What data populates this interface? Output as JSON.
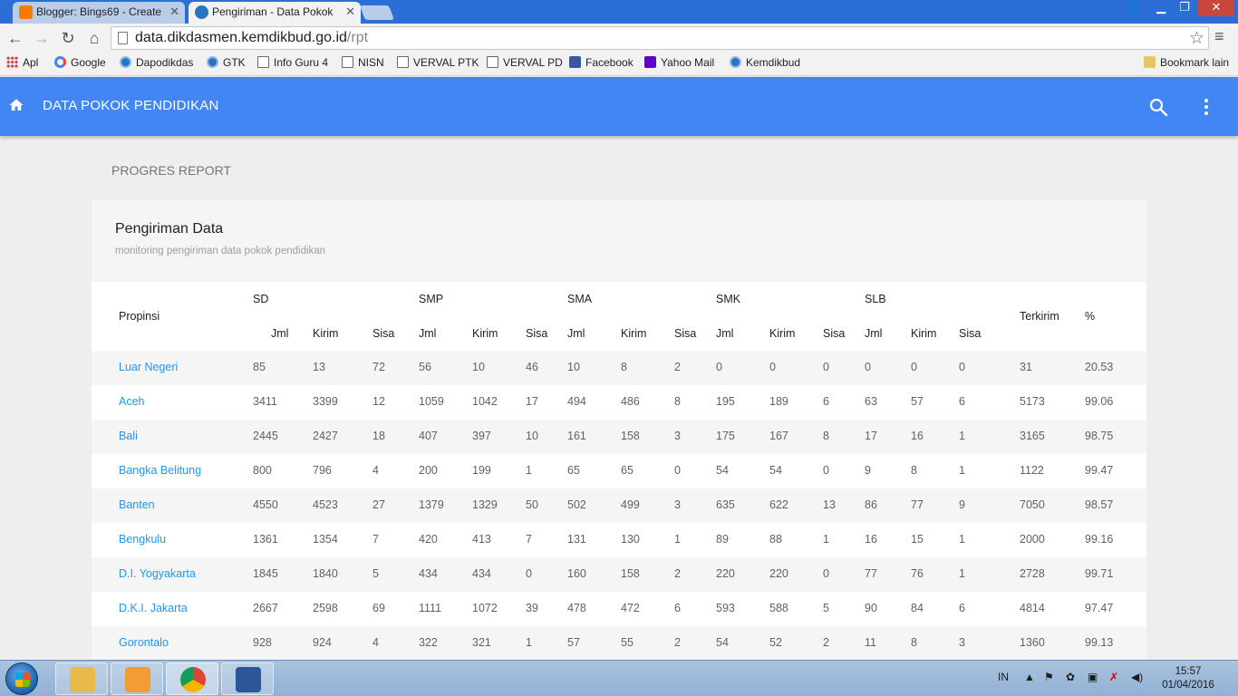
{
  "browser": {
    "tabs": [
      {
        "title": "Blogger: Bings69 - Create",
        "favicon": "blogger-icon",
        "color": "#f57c00"
      },
      {
        "title": "Pengiriman - Data Pokok",
        "favicon": "kemdikbud-icon",
        "color": "#2a73c0"
      }
    ],
    "url_host": "data.dikdasmen.kemdikbud.go.id",
    "url_path": "/rpt",
    "bookmarks": [
      {
        "label": "Apl",
        "icon": "apps-grid-icon"
      },
      {
        "label": "Google",
        "icon": "google-icon"
      },
      {
        "label": "Dapodikdas",
        "icon": "globe-icon"
      },
      {
        "label": "GTK",
        "icon": "globe-icon"
      },
      {
        "label": "Info Guru 4",
        "icon": "page-icon"
      },
      {
        "label": "NISN",
        "icon": "page-icon"
      },
      {
        "label": "VERVAL PTK",
        "icon": "page-icon"
      },
      {
        "label": "VERVAL PD",
        "icon": "page-icon"
      },
      {
        "label": "Facebook",
        "icon": "facebook-icon"
      },
      {
        "label": "Yahoo Mail",
        "icon": "yahoo-icon"
      },
      {
        "label": "Kemdikbud",
        "icon": "globe-icon"
      }
    ],
    "other_bookmarks": "Bookmark lain"
  },
  "app": {
    "title": "DATA POKOK PENDIDIKAN",
    "accent": "#4285f4",
    "breadcrumb": "PROGRES REPORT",
    "card_title": "Pengiriman Data",
    "card_subtitle": "monitoring pengiriman data pokok pendidikan"
  },
  "table": {
    "province_header": "Propinsi",
    "groups": [
      "SD",
      "SMP",
      "SMA",
      "SMK",
      "SLB"
    ],
    "sub_headers": [
      "Jml",
      "Kirim",
      "Sisa"
    ],
    "terkirim_header": "Terkirim",
    "percent_header": "%",
    "rows": [
      {
        "prov": "Luar Negeri",
        "v": [
          "85",
          "13",
          "72",
          "56",
          "10",
          "46",
          "10",
          "8",
          "2",
          "0",
          "0",
          "0",
          "0",
          "0",
          "0"
        ],
        "terkirim": "31",
        "pct": "20.53"
      },
      {
        "prov": "Aceh",
        "v": [
          "3411",
          "3399",
          "12",
          "1059",
          "1042",
          "17",
          "494",
          "486",
          "8",
          "195",
          "189",
          "6",
          "63",
          "57",
          "6"
        ],
        "terkirim": "5173",
        "pct": "99.06"
      },
      {
        "prov": "Bali",
        "v": [
          "2445",
          "2427",
          "18",
          "407",
          "397",
          "10",
          "161",
          "158",
          "3",
          "175",
          "167",
          "8",
          "17",
          "16",
          "1"
        ],
        "terkirim": "3165",
        "pct": "98.75"
      },
      {
        "prov": "Bangka Belitung",
        "v": [
          "800",
          "796",
          "4",
          "200",
          "199",
          "1",
          "65",
          "65",
          "0",
          "54",
          "54",
          "0",
          "9",
          "8",
          "1"
        ],
        "terkirim": "1122",
        "pct": "99.47"
      },
      {
        "prov": "Banten",
        "v": [
          "4550",
          "4523",
          "27",
          "1379",
          "1329",
          "50",
          "502",
          "499",
          "3",
          "635",
          "622",
          "13",
          "86",
          "77",
          "9"
        ],
        "terkirim": "7050",
        "pct": "98.57"
      },
      {
        "prov": "Bengkulu",
        "v": [
          "1361",
          "1354",
          "7",
          "420",
          "413",
          "7",
          "131",
          "130",
          "1",
          "89",
          "88",
          "1",
          "16",
          "15",
          "1"
        ],
        "terkirim": "2000",
        "pct": "99.16"
      },
      {
        "prov": "D.I. Yogyakarta",
        "v": [
          "1845",
          "1840",
          "5",
          "434",
          "434",
          "0",
          "160",
          "158",
          "2",
          "220",
          "220",
          "0",
          "77",
          "76",
          "1"
        ],
        "terkirim": "2728",
        "pct": "99.71"
      },
      {
        "prov": "D.K.I. Jakarta",
        "v": [
          "2667",
          "2598",
          "69",
          "1111",
          "1072",
          "39",
          "478",
          "472",
          "6",
          "593",
          "588",
          "5",
          "90",
          "84",
          "6"
        ],
        "terkirim": "4814",
        "pct": "97.47"
      },
      {
        "prov": "Gorontalo",
        "v": [
          "928",
          "924",
          "4",
          "322",
          "321",
          "1",
          "57",
          "55",
          "2",
          "54",
          "52",
          "2",
          "11",
          "8",
          "3"
        ],
        "terkirim": "1360",
        "pct": "99.13"
      }
    ]
  },
  "taskbar": {
    "apps": [
      {
        "name": "explorer-icon",
        "color": "#e9b949"
      },
      {
        "name": "media-player-icon",
        "color": "#f39c34"
      },
      {
        "name": "chrome-icon",
        "color": "#db4437"
      },
      {
        "name": "word-icon",
        "color": "#2b579a"
      }
    ],
    "language": "IN",
    "time": "15:57",
    "date": "01/04/2016"
  }
}
